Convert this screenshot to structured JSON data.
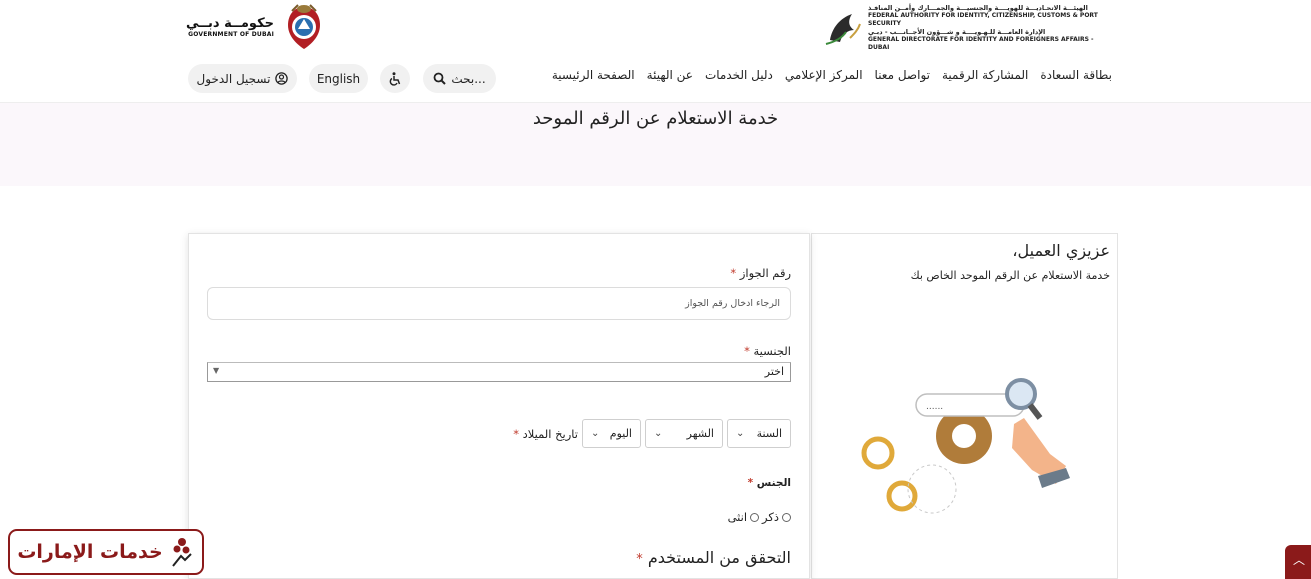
{
  "header": {
    "gov_name_ar": "حكومــة دبــي",
    "gov_name_en": "GOVERNMENT OF DUBAI",
    "authority_ar": "الهيئـــة الاتحـاديـــة للهويــــة والجنسيـــة والجمـــارك وأمــن المنافـذ",
    "authority_en": "FEDERAL AUTHORITY FOR IDENTITY, CITIZENSHIP, CUSTOMS & PORT SECURITY",
    "directorate_ar": "الإدارة العامـــة للـهـويــــة و شـــؤون الأجــانـــب - دبـي",
    "directorate_en": "GENERAL DIRECTORATE FOR IDENTITY AND FOREIGNERS AFFAIRS - DUBAI"
  },
  "nav": {
    "items": [
      {
        "label": "الصفحة الرئيسية"
      },
      {
        "label": "عن الهيئة"
      },
      {
        "label": "دليل الخدمات"
      },
      {
        "label": "المركز الإعلامي"
      },
      {
        "label": "تواصل معنا"
      },
      {
        "label": "المشاركة الرقمية"
      },
      {
        "label": "بطاقة السعادة"
      }
    ],
    "search_label": "بحث...",
    "language_label": "English",
    "login_label": "تسجيل الدخول"
  },
  "banner": {
    "title": "خدمة الاستعلام عن الرقم الموحد"
  },
  "info": {
    "title": "عزيزي العميل،",
    "subtitle": "خدمة الاستعلام عن الرقم الموحد الخاص بك",
    "illustration_search_text": "......"
  },
  "form": {
    "passport_label": "رقم الجواز",
    "passport_placeholder": "الرجاء ادخال رقم الجواز",
    "nationality_label": "الجنسية",
    "nationality_value": "اختر",
    "dob_label": "تاريخ الميلاد",
    "day_label": "اليوم",
    "month_label": "الشهر",
    "year_label": "السنة",
    "gender_label": "الجنس",
    "male_label": "ذكر",
    "female_label": "انثى",
    "verify_label": "التحقق من المستخدم",
    "required_mark": "*"
  },
  "badge": {
    "text": "خدمات الإمارات"
  },
  "colors": {
    "brand": "#8b1a1a",
    "required": "#c0392b",
    "banner_bg": "#fbf7fb"
  }
}
